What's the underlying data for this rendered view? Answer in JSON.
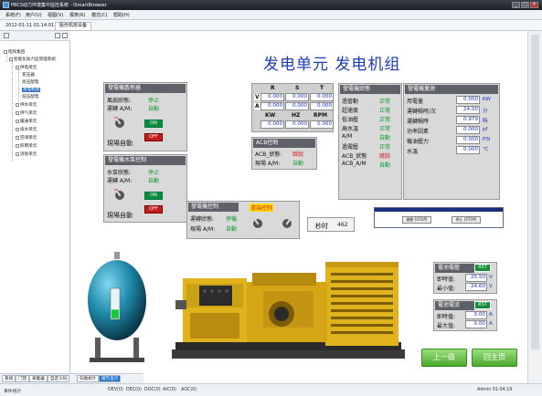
{
  "window": {
    "title": "PBCS动力环境集中监控系统 - iSmartBrowser",
    "controls": [
      "_",
      "□",
      "×"
    ]
  },
  "menu": {
    "items": [
      "系统(F)",
      "用户(U)",
      "视图(V)",
      "报表(R)",
      "模式(C)",
      "帮助(H)"
    ]
  },
  "tabbar": {
    "datetime": "2012-01-11 01:14:01",
    "tab_label": "股份机房设备"
  },
  "tree": {
    "items": [
      {
        "label": "昭和集团",
        "level": 0,
        "selected": false
      },
      {
        "label": "智能化动力监管理系统",
        "level": 1,
        "selected": false
      },
      {
        "label": "供电单元",
        "level": 2,
        "selected": false
      },
      {
        "label": "变压器",
        "level": 3,
        "selected": false
      },
      {
        "label": "高压配电",
        "level": 3,
        "selected": false
      },
      {
        "label": "发电机组",
        "level": 3,
        "selected": true
      },
      {
        "label": "低压配电",
        "level": 3,
        "selected": false
      },
      {
        "label": "供水单元",
        "level": 2,
        "selected": false
      },
      {
        "label": "供气单元",
        "level": 2,
        "selected": false
      },
      {
        "label": "暖通单元",
        "level": 2,
        "selected": false
      },
      {
        "label": "排水单元",
        "level": 2,
        "selected": false
      },
      {
        "label": "空调单元",
        "level": 2,
        "selected": false
      },
      {
        "label": "照明单元",
        "level": 2,
        "selected": false
      },
      {
        "label": "消防单元",
        "level": 2,
        "selected": false
      }
    ]
  },
  "bottom_tabs": [
    "系统",
    "门禁",
    "采集器",
    "自定义码",
    "归类统计",
    "报告显示"
  ],
  "status": {
    "left": "事件统计",
    "codes": [
      "DEV(0)",
      "DEC(0)",
      "DOC(0)",
      "AIC(0)",
      "AOC(0)"
    ],
    "user": "Admin 01:04:19"
  },
  "page": {
    "title": "发电单元 发电机组"
  },
  "radiator": {
    "header": "發電機散熱器",
    "fan_label": "風扇狀態:",
    "fan_value": "停止",
    "mode_label": "運轉 A/M:",
    "mode_value": "自動",
    "site_label": "現場自動",
    "on": "ON",
    "off": "OFF",
    "switch_text": "MS"
  },
  "water_pump": {
    "header": "發電機水泵控制",
    "pump_label": "水泵狀態:",
    "pump_value": "停止",
    "mode_label": "運轉 A/M:",
    "mode_value": "自動",
    "site_label": "現場自動",
    "on": "ON",
    "off": "OFF",
    "switch_text": "MS"
  },
  "meter": {
    "cols": [
      "R",
      "S",
      "T"
    ],
    "rows": [
      {
        "label": "V",
        "values": [
          "0.000",
          "0.000",
          "0.000"
        ]
      },
      {
        "label": "A",
        "values": [
          "0.000",
          "0.000",
          "0.000"
        ]
      }
    ],
    "cols2": [
      "KW",
      "HZ",
      "RPM"
    ],
    "values2": [
      "0.000",
      "0.000",
      "0.000"
    ]
  },
  "acb": {
    "header": "ACB控制",
    "status_label": "ACB_狀態:",
    "status_value": "跳脫",
    "site_label": "現場 A/M:",
    "site_value": "自動"
  },
  "gen_status": {
    "header": "發電機狀態",
    "items": [
      {
        "label": "過管動",
        "value": "正常"
      },
      {
        "label": "超速度",
        "value": "正常"
      },
      {
        "label": "低油壓",
        "value": "正常"
      },
      {
        "label": "高水溫",
        "value": "正常"
      },
      {
        "label": "A/M",
        "value": "自動"
      },
      {
        "label": "過電壓",
        "value": "正常"
      },
      {
        "label": "ACB_狀態",
        "value": "跳脫"
      },
      {
        "label": "ACB_A/M",
        "value": "自動"
      }
    ]
  },
  "gen_measure": {
    "header": "發電機量測",
    "items": [
      {
        "label": "用電量",
        "value": "0.000",
        "unit": "KW"
      },
      {
        "label": "運轉積時/次",
        "value": "24.00",
        "unit": "分"
      },
      {
        "label": "運轉積時",
        "value": "0.979",
        "unit": "時"
      },
      {
        "label": "功率因素",
        "value": "0.000",
        "unit": "pf"
      },
      {
        "label": "機油壓力",
        "value": "0.000",
        "unit": "PSI"
      },
      {
        "label": "水溫",
        "value": "0.000",
        "unit": "℃"
      }
    ]
  },
  "gen_control": {
    "header": "發電機控制",
    "remote_label": "遠端控制",
    "run_label": "運轉狀態:",
    "run_value": "停機",
    "site_label": "現場 A/M:",
    "site_value": "自動"
  },
  "runtime": {
    "label": "秒时",
    "value": "462"
  },
  "dialog": {
    "btn1": "啟動 [STOP]",
    "btn2": "停止 [STOP]"
  },
  "battery_voltage": {
    "header": "電池電壓",
    "rst": "RST",
    "rows": [
      {
        "label": "即時值:",
        "value": "25.50",
        "unit": "V"
      },
      {
        "label": "最小值:",
        "value": "24.60",
        "unit": "V"
      }
    ]
  },
  "battery_current": {
    "header": "電池電流",
    "rst": "RST",
    "rows": [
      {
        "label": "即時值:",
        "value": "0.00",
        "unit": "A"
      },
      {
        "label": "最大值:",
        "value": "0.00",
        "unit": "A"
      }
    ]
  },
  "tank": {
    "level_percent": 30
  },
  "nav": {
    "prev": "上一级",
    "home": "回主页"
  },
  "colors": {
    "title_blue": "#1f3ab8",
    "panel_header": "#5f6169",
    "ok_green": "#0a9b2e",
    "alarm_red": "#d21c1c",
    "value_blue": "#1a34c8",
    "button_green": "#4aa92c"
  }
}
